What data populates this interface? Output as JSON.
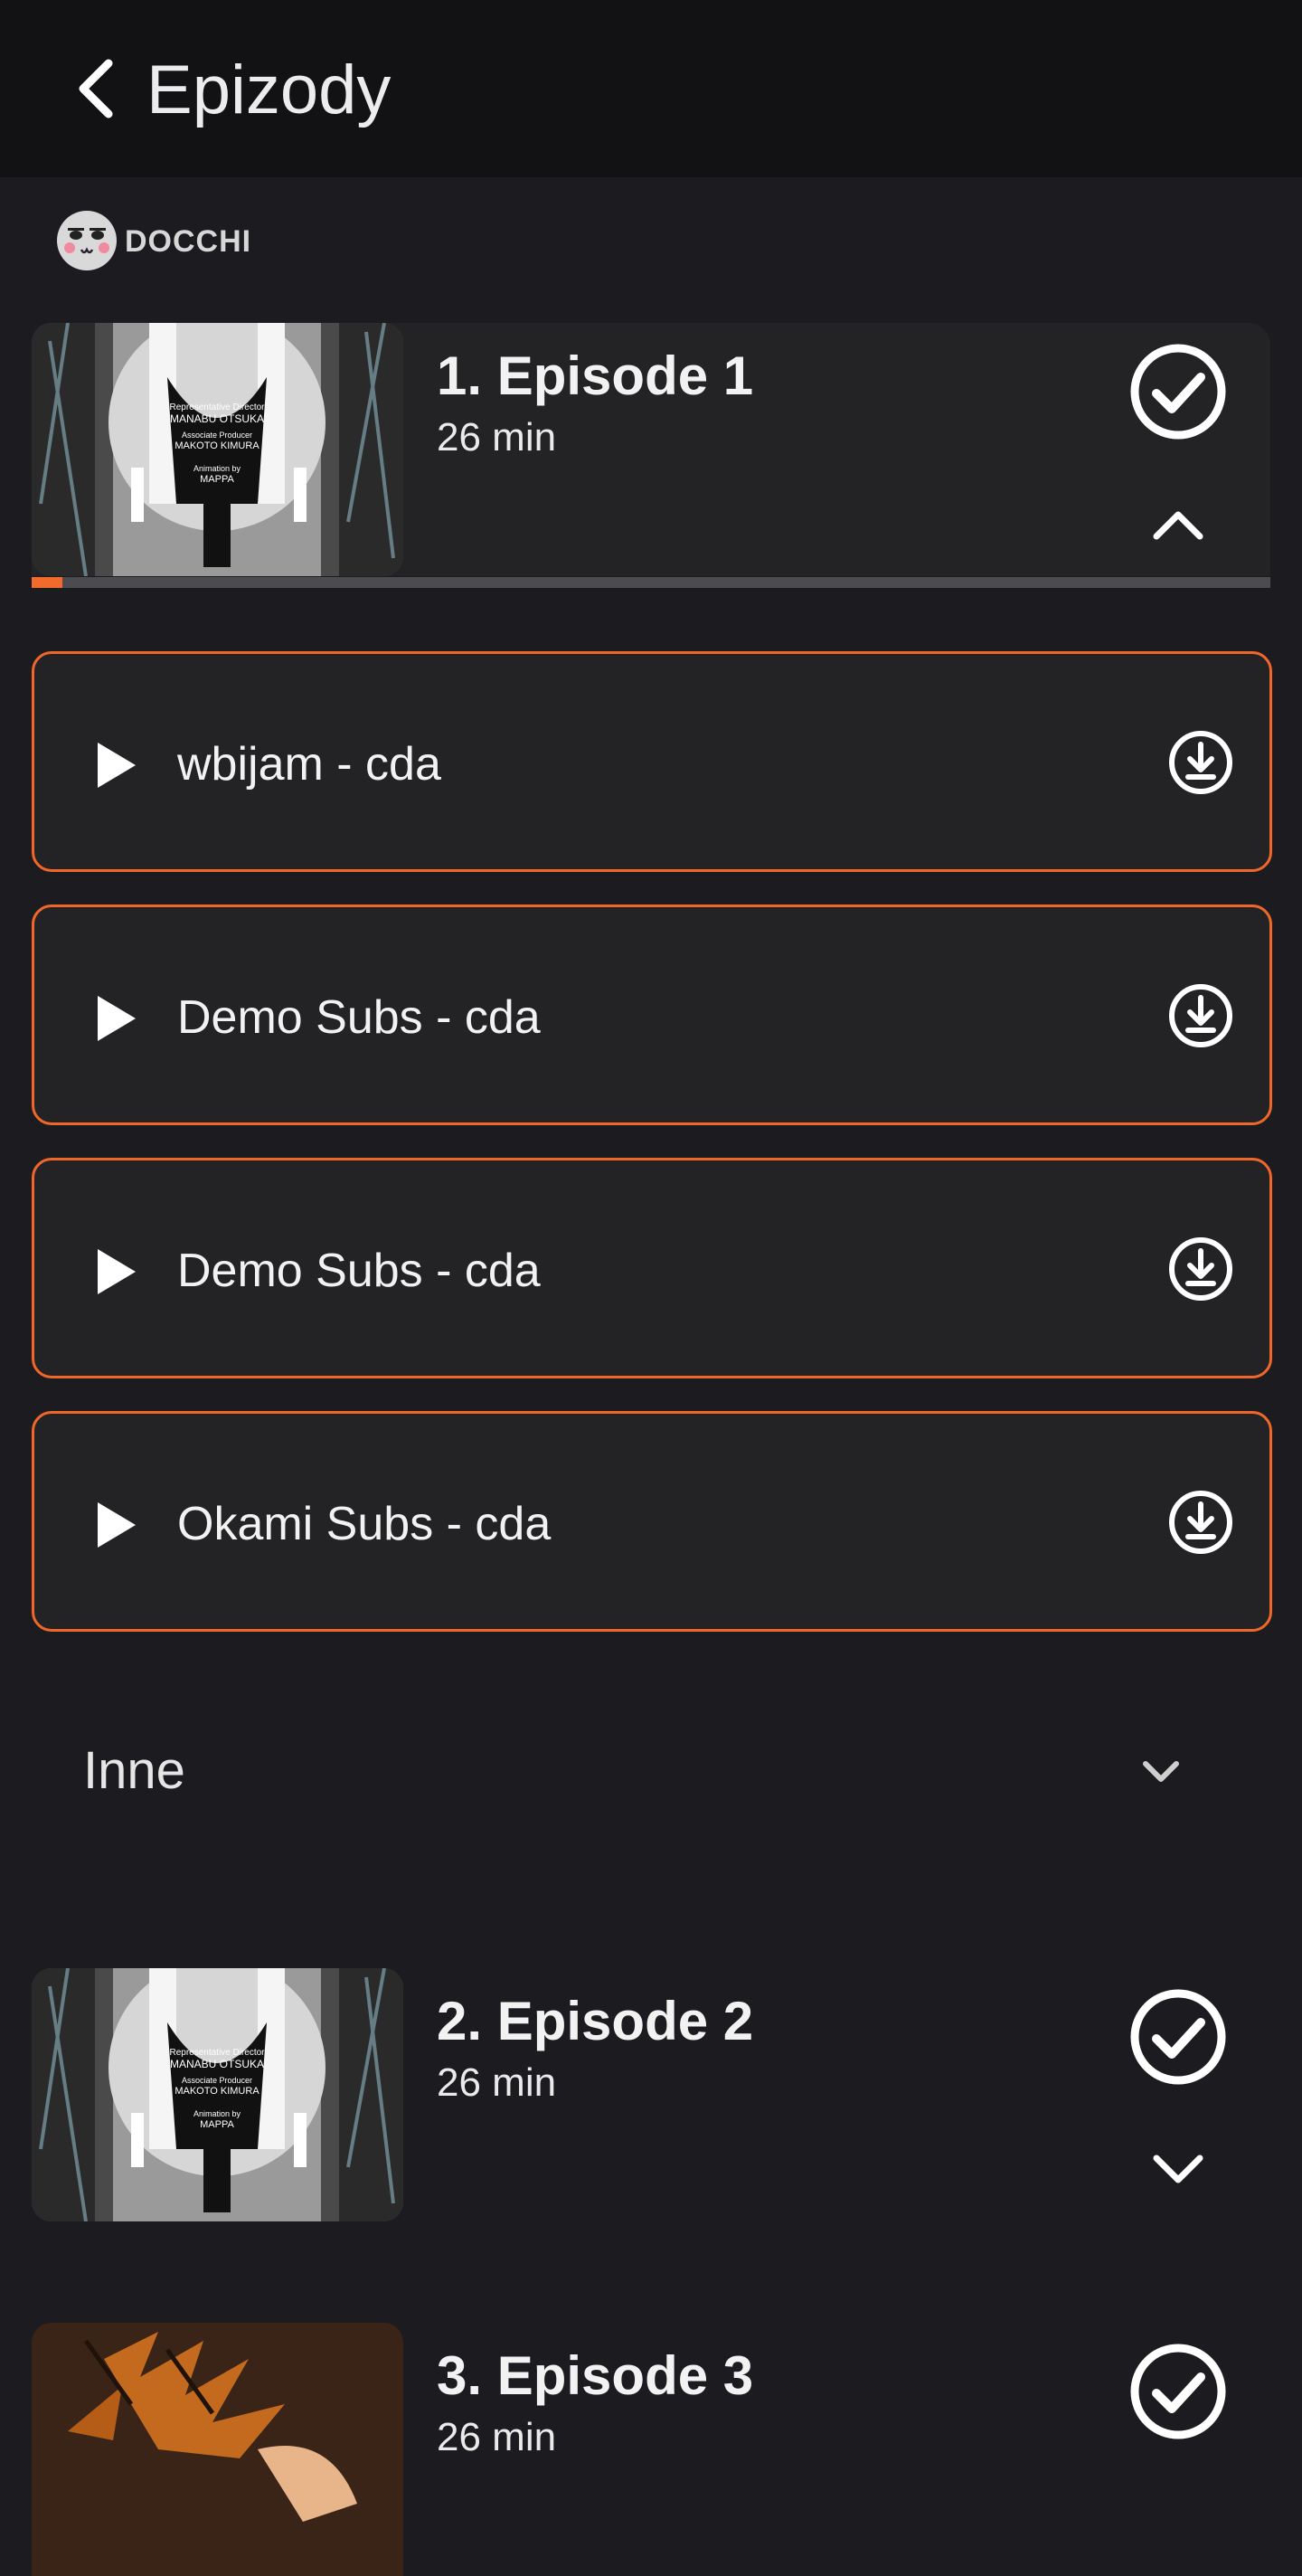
{
  "header": {
    "title": "Epizody",
    "back_icon": "chevron-left-icon"
  },
  "brand": {
    "name": "DOCCHI",
    "logo_icon": "face-logo-icon"
  },
  "thumbnail_text": {
    "director_role": "Representative Director",
    "director_name": "MANABU OTSUKA",
    "producer_role": "Associate Producer",
    "producer_name": "MAKOTO KIMURA",
    "animation_role": "Animation by",
    "animation_name": "MAPPA"
  },
  "episodes": [
    {
      "title": "1. Episode 1",
      "duration": "26 min",
      "watched_icon": "check-circle-icon",
      "toggle_icon": "chevron-up-icon",
      "progress": 0.025
    },
    {
      "title": "2. Episode 2",
      "duration": "26 min",
      "watched_icon": "check-circle-icon",
      "toggle_icon": "chevron-down-icon"
    },
    {
      "title": "3. Episode 3",
      "duration": "26 min",
      "watched_icon": "check-circle-icon"
    }
  ],
  "sources": [
    {
      "label": "wbijam - cda",
      "play_icon": "play-icon",
      "action_icon": "download-icon"
    },
    {
      "label": "Demo Subs - cda",
      "play_icon": "play-icon",
      "action_icon": "download-icon"
    },
    {
      "label": "Demo Subs - cda",
      "play_icon": "play-icon",
      "action_icon": "download-icon"
    },
    {
      "label": "Okami Subs - cda",
      "play_icon": "play-icon",
      "action_icon": "download-icon"
    }
  ],
  "other_section": {
    "label": "Inne",
    "icon": "chevron-down-icon"
  },
  "colors": {
    "background": "#1c1b20",
    "topbar": "#121214",
    "card": "#232326",
    "accent": "#f0672a",
    "progress_track": "#4b4b50"
  }
}
